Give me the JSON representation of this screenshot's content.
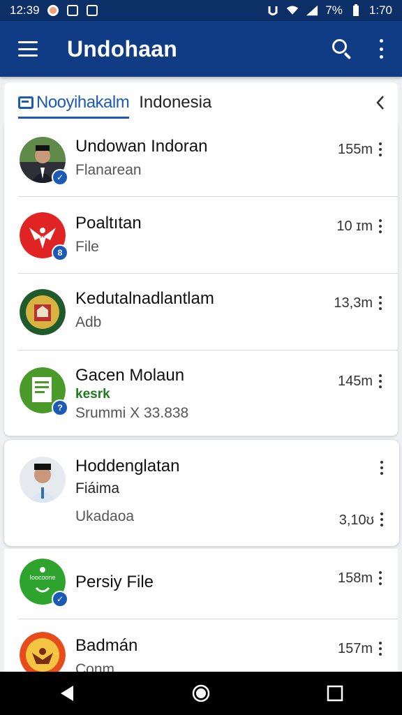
{
  "status_bar": {
    "time_left": "12:39",
    "percent": "7%",
    "time_right": "1:70"
  },
  "app_bar": {
    "title": "Undohaan",
    "menu_icon": "hamburger-menu-icon",
    "search_icon": "search-icon",
    "overflow_icon": "more-vert-icon"
  },
  "section": {
    "active_tab": "Nooyihakalm",
    "secondary_label": "Indonesia",
    "back_icon": "chevron-left-icon"
  },
  "colors": {
    "app_bar": "#0f3c84",
    "status_bar": "#0b2f66",
    "accent": "#1c5bb5",
    "green_text": "#1f7a1f"
  },
  "items": [
    {
      "title": "Undowan Indoran",
      "subtitle": "Flanarean",
      "size": "155m",
      "avatar": "person-portrait",
      "badge": "✓"
    },
    {
      "title": "Poaltıtan",
      "subtitle": "File",
      "size": "10 ɪm",
      "avatar": "red-eagle-emblem",
      "badge": "8"
    },
    {
      "title": "Kedutalnadlantlam",
      "subtitle": "Adb",
      "size": "13,3m",
      "avatar": "green-crest-emblem",
      "badge": ""
    },
    {
      "title": "Gacen Molaun",
      "tag": "kesrk",
      "subtitle": "Srummi X 33.838",
      "size": "145m",
      "avatar": "green-document-icon",
      "badge": "?"
    },
    {
      "title": "Hoddenglatan",
      "subtitle": "Fiáima",
      "detail": "Ukadaoa",
      "size": "3,10ʊ",
      "avatar": "person-portrait-2",
      "badge": ""
    },
    {
      "title": "Persiy File",
      "subtitle": "",
      "size": "158m",
      "avatar": "green-circle-logo",
      "avatar_text": "Ioocoone",
      "badge": "✓"
    },
    {
      "title": "Badmán",
      "subtitle": "Conm",
      "size": "157m",
      "avatar": "orange-garuda-emblem",
      "badge": ""
    }
  ]
}
